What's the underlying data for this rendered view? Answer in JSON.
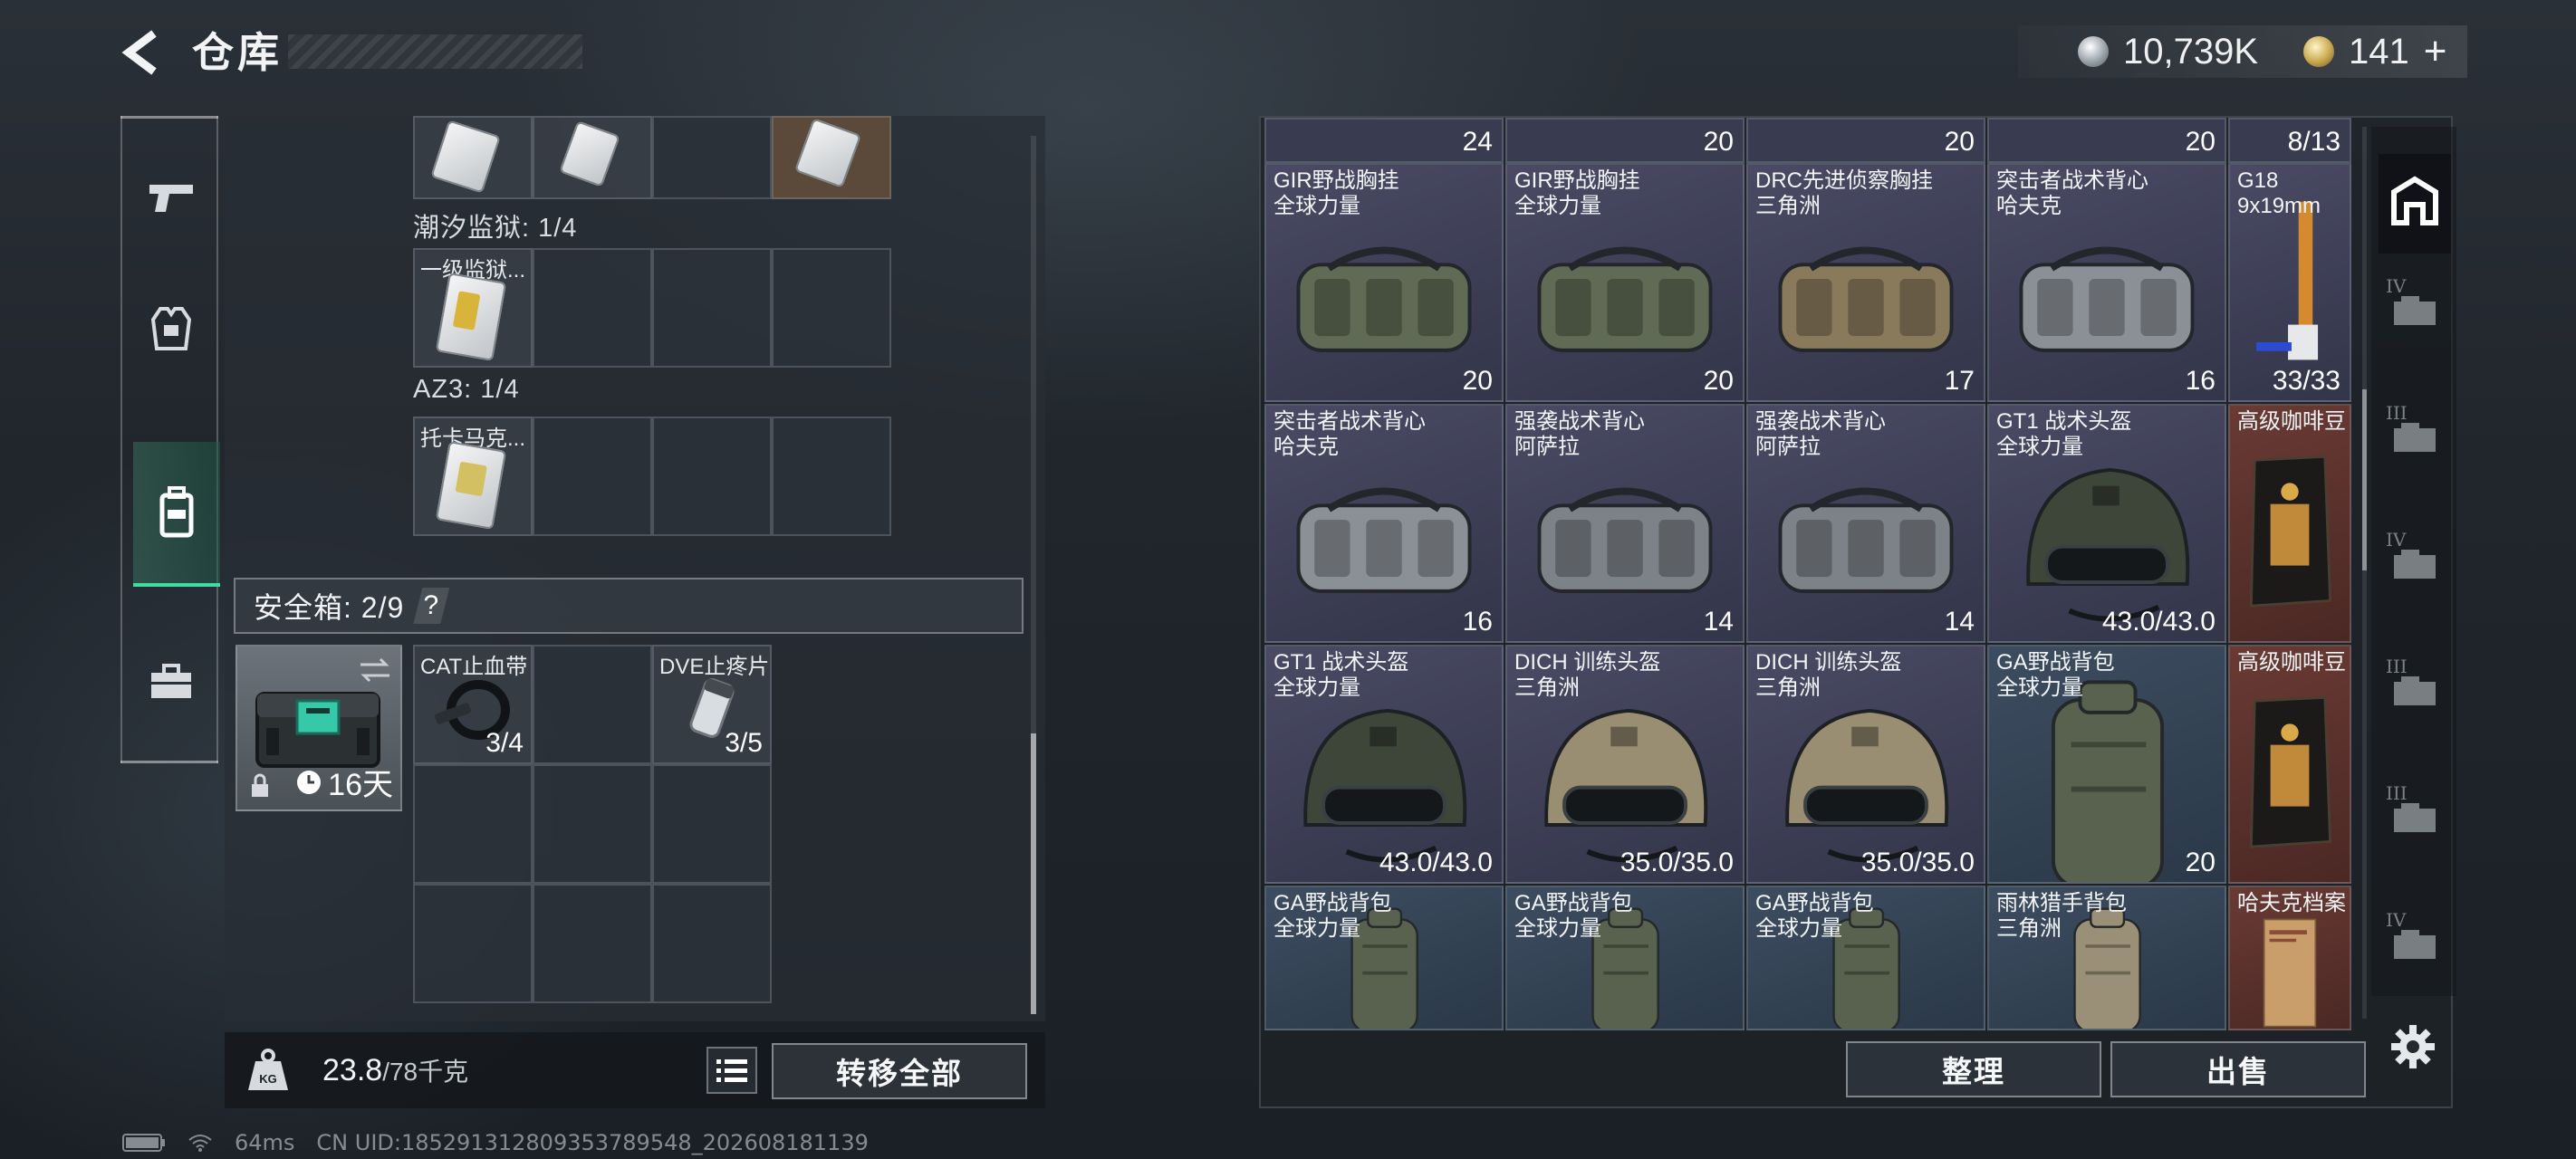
{
  "header": {
    "title": "仓库",
    "back_icon": "back-arrow-icon",
    "currency": [
      {
        "icon": "silver-coin-icon",
        "value": "10,739K"
      },
      {
        "icon": "gold-coin-icon",
        "value": "141",
        "add": "+"
      }
    ]
  },
  "categories": [
    {
      "name": "weapons",
      "icon": "pistol-icon"
    },
    {
      "name": "armor",
      "icon": "vest-icon"
    },
    {
      "name": "backpack",
      "icon": "backpack-icon",
      "active": true
    },
    {
      "name": "case",
      "icon": "toolbox-icon"
    }
  ],
  "left": {
    "prison_label": "潮汐监狱: 1/4",
    "prison_card": "一级监狱...",
    "az3_label": "AZ3: 1/4",
    "az3_card": "托卡马克...",
    "safe_label": "安全箱: 2/9",
    "safe_help": "?",
    "safebox_days": "16天",
    "safe_items": [
      {
        "name": "CAT止血带",
        "count": "3/4"
      },
      {
        "name": "DVE止疼片",
        "count": "3/5"
      }
    ],
    "weight_value": "23.8",
    "weight_max": "/78千克",
    "transfer_all": "转移全部"
  },
  "top_strip": [
    "24",
    "20",
    "20",
    "20",
    "8/13"
  ],
  "items": [
    {
      "name": "GIR野战胸挂\n全球力量",
      "value": "20",
      "tone": "purple",
      "kind": "rig",
      "color": "#5f6b55"
    },
    {
      "name": "GIR野战胸挂\n全球力量",
      "value": "20",
      "tone": "purple",
      "kind": "rig",
      "color": "#5f6b55"
    },
    {
      "name": "DRC先进侦察胸挂\n三角洲",
      "value": "17",
      "tone": "purple",
      "kind": "rig",
      "color": "#8a7a5c"
    },
    {
      "name": "突击者战术背心\n哈夫克",
      "value": "16",
      "tone": "purple",
      "kind": "rig",
      "color": "#8b9097"
    },
    {
      "name": "G18\n9x19mm",
      "value": "33/33",
      "tone": "purple",
      "kind": "pistol"
    },
    {
      "name": "突击者战术背心\n哈夫克",
      "value": "16",
      "tone": "purple",
      "kind": "rig",
      "color": "#8b9097"
    },
    {
      "name": "强袭战术背心\n阿萨拉",
      "value": "14",
      "tone": "purple",
      "kind": "rig",
      "color": "#7d8288"
    },
    {
      "name": "强袭战术背心\n阿萨拉",
      "value": "14",
      "tone": "purple",
      "kind": "rig",
      "color": "#7d8288"
    },
    {
      "name": "GT1 战术头盔\n全球力量",
      "value": "43.0/43.0",
      "tone": "purple",
      "kind": "helmet",
      "color": "#3e463a"
    },
    {
      "name": "高级咖啡豆",
      "value": "",
      "tone": "red",
      "kind": "coffee"
    },
    {
      "name": "GT1 战术头盔\n全球力量",
      "value": "43.0/43.0",
      "tone": "purple",
      "kind": "helmet",
      "color": "#3e463a"
    },
    {
      "name": "DICH 训练头盔\n三角洲",
      "value": "35.0/35.0",
      "tone": "purple",
      "kind": "helmet",
      "color": "#9a8e72"
    },
    {
      "name": "DICH 训练头盔\n三角洲",
      "value": "35.0/35.0",
      "tone": "purple",
      "kind": "helmet",
      "color": "#9a8e72"
    },
    {
      "name": "GA野战背包\n全球力量",
      "value": "20",
      "tone": "blue",
      "kind": "bag",
      "color": "#59624e"
    },
    {
      "name": "高级咖啡豆",
      "value": "",
      "tone": "red",
      "kind": "coffee"
    },
    {
      "name": "GA野战背包\n全球力量",
      "value": "",
      "tone": "blue",
      "kind": "bag",
      "color": "#59624e"
    },
    {
      "name": "GA野战背包\n全球力量",
      "value": "",
      "tone": "blue",
      "kind": "bag",
      "color": "#59624e"
    },
    {
      "name": "GA野战背包\n全球力量",
      "value": "",
      "tone": "blue",
      "kind": "bag",
      "color": "#59624e"
    },
    {
      "name": "雨林猎手背包\n三角洲",
      "value": "",
      "tone": "blue",
      "kind": "bag",
      "color": "#9a9078"
    },
    {
      "name": "哈夫克档案",
      "value": "",
      "tone": "red",
      "kind": "doc"
    }
  ],
  "side_tabs": [
    {
      "tier": "",
      "icon": "all-items-icon",
      "active": true
    },
    {
      "tier": "IV",
      "icon": "container-icon"
    },
    {
      "tier": "III",
      "icon": "gloves-icon"
    },
    {
      "tier": "IV",
      "icon": "medkit-icon"
    },
    {
      "tier": "III",
      "icon": "hand-item-icon"
    },
    {
      "tier": "III",
      "icon": "device-icon"
    },
    {
      "tier": "IV",
      "icon": "crate-icon"
    }
  ],
  "buttons": {
    "sort": "整理",
    "sell": "出售"
  },
  "status": {
    "ping": "64ms",
    "uid": "CN UID:1852913128093537895​48_202608181139"
  }
}
